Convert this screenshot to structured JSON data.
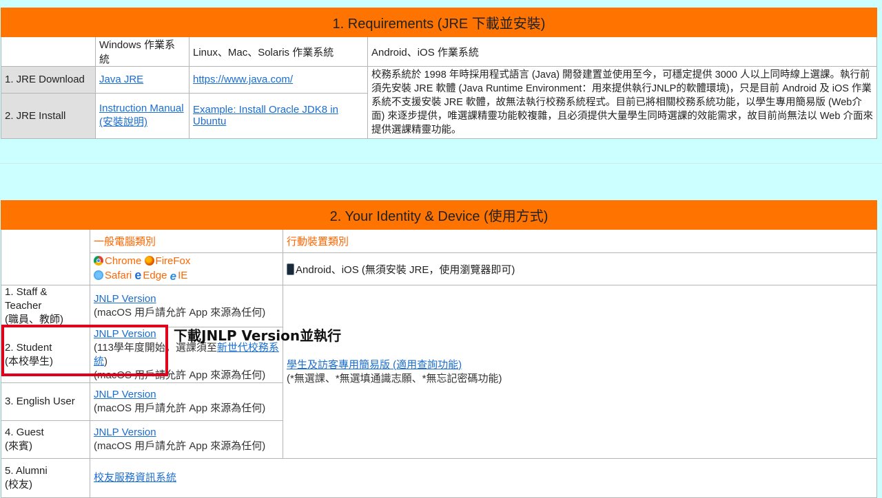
{
  "requirements": {
    "title": "1. Requirements (JRE 下載並安裝)",
    "col_windows": "Windows 作業系統",
    "col_linux": "Linux、Mac、Solaris 作業系統",
    "col_mobile": "Android、iOS 作業系統",
    "row_download_label": "1. JRE Download",
    "row_download_win_link": "Java JRE",
    "row_download_linux_link": "https://www.java.com/",
    "row_install_label": "2. JRE Install",
    "row_install_win_link_line1": "Instruction Manual",
    "row_install_win_link_line2": "(安裝說明)",
    "row_install_linux_link": "Example: Install Oracle JDK8 in Ubuntu",
    "mobile_description": "校務系統於 1998 年時採用程式語言 (Java) 開發建置並使用至今，可穩定提供 3000 人以上同時線上選課。執行前須先安裝 JRE 軟體 (Java Runtime Environment：用來提供執行JNLP的軟體環境)，只是目前 Android 及 iOS 作業系統不支援安裝 JRE 軟體，故無法執行校務系統程式。目前已將相關校務系統功能，以學生專用簡易版 (Web介面) 來逐步提供，唯選課精靈功能較複雜，且必須提供大量學生同時選課的效能需求，故目前尚無法以 Web 介面來提供選課精靈功能。"
  },
  "identity": {
    "title": "2. Your Identity & Device (使用方式)",
    "col_pc": "一般電腦類別",
    "col_mobile": "行動裝置類別",
    "browsers": {
      "chrome": "Chrome",
      "firefox": "FireFox",
      "safari": "Safari",
      "edge": "Edge",
      "ie": "IE"
    },
    "mobile_device_text": "Android、iOS (無須安裝 JRE，使用瀏覽器即可)",
    "jnlp_link": "JNLP Version",
    "macos_note": "(macOS 用戶請允許 App 來源為任何)",
    "student_note_prefix": "(113學年度開始，選課須至",
    "student_note_link": "新世代校務系統",
    "student_note_suffix": ")",
    "rows": {
      "staff": {
        "line1": "1. Staff & Teacher",
        "line2": "(職員、教師)"
      },
      "student": {
        "line1": "2. Student",
        "line2": "(本校學生)"
      },
      "english": {
        "line1": "3. English User"
      },
      "guest": {
        "line1": "4. Guest",
        "line2": "(來賓)"
      },
      "alumni": {
        "line1": "5. Alumni",
        "line2": "(校友)"
      }
    },
    "mobile_web_link": "學生及訪客專用簡易版 (適用查詢功能)",
    "mobile_web_note": "(*無選課、*無選填通識志願、*無忘記密碼功能)",
    "alumni_link": "校友服務資訊系統"
  },
  "annotation": {
    "callout_text": "下載JNLP Version並執行",
    "highlight_color": "#e0001b"
  },
  "colors": {
    "header_orange": "#ff7300",
    "page_background": "#ccffff",
    "link_blue": "#1a6dd1"
  }
}
